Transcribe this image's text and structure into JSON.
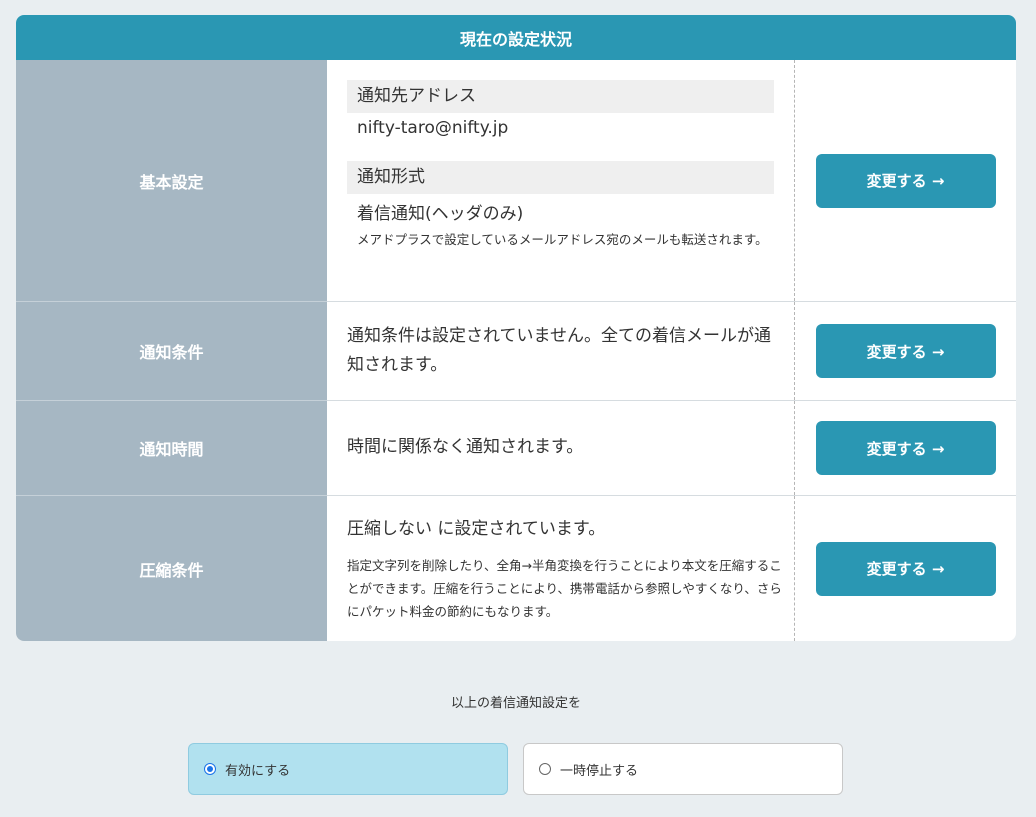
{
  "panel": {
    "title": "現在の設定状況",
    "change_label": "変更する →"
  },
  "basic": {
    "label": "基本設定",
    "address_head": "通知先アドレス",
    "address_value": "nifty-taro@nifty.jp",
    "format_head": "通知形式",
    "format_value": "着信通知(ヘッダのみ)",
    "format_note": "メアドプラスで設定しているメールアドレス宛のメールも転送されます。"
  },
  "condition": {
    "label": "通知条件",
    "text": "通知条件は設定されていません。全ての着信メールが通知されます。"
  },
  "time": {
    "label": "通知時間",
    "text": "時間に関係なく通知されます。"
  },
  "compress": {
    "label": "圧縮条件",
    "text": "圧縮しない に設定されています。",
    "note": "指定文字列を削除したり、全角→半角変換を行うことにより本文を圧縮することができます。圧縮を行うことにより、携帯電話から参照しやすくなり、さらにパケット料金の節約にもなります。"
  },
  "footer": {
    "caption": "以上の着信通知設定を",
    "enable_label": "有効にする",
    "pause_label": "一時停止する",
    "selected": "有効にする"
  }
}
